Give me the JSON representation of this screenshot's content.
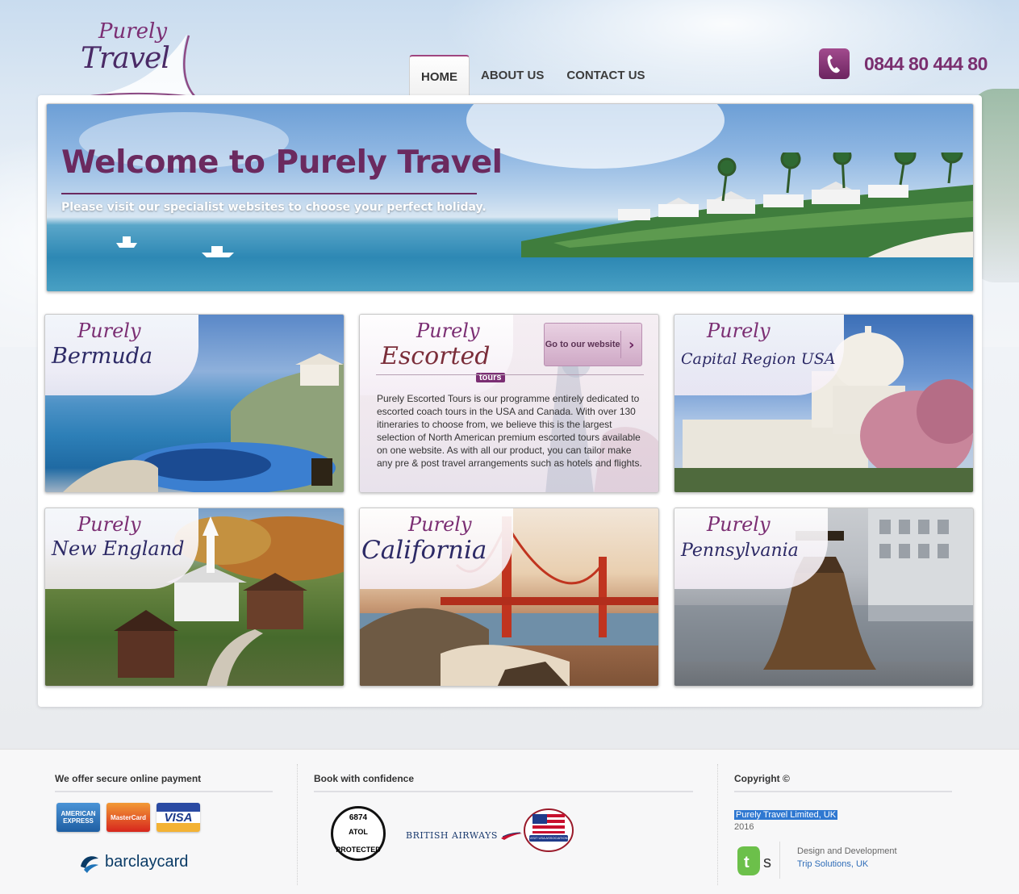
{
  "header": {
    "logo_top": "Purely",
    "logo_bottom": "Travel",
    "nav": [
      {
        "label": "HOME",
        "active": true
      },
      {
        "label": "ABOUT US",
        "active": false
      },
      {
        "label": "CONTACT US",
        "active": false
      }
    ],
    "phone": "0844 80 444 80"
  },
  "hero": {
    "title": "Welcome to Purely Travel",
    "subtitle": "Please visit our specialist websites to choose your perfect holiday."
  },
  "tiles": [
    {
      "prefix": "Purely",
      "name": "Bermuda"
    },
    {
      "prefix": "Purely",
      "name": "Escorted",
      "tag": "tours",
      "cta": "Go to our website",
      "description": "Purely Escorted Tours is our programme entirely dedicated to escorted coach tours in the USA and Canada. With over 130 itineraries to choose from, we believe this is the largest selection of North American premium escorted tours available on one website. As with all our product, you can tailor make any pre & post travel arrangements such as hotels and flights."
    },
    {
      "prefix": "Purely",
      "name": "Capital Region USA"
    },
    {
      "prefix": "Purely",
      "name": "New England"
    },
    {
      "prefix": "Purely",
      "name": "California"
    },
    {
      "prefix": "Purely",
      "name": "Pennsylvania"
    }
  ],
  "footer": {
    "payment_heading": "We offer secure online payment",
    "cards": [
      "AMERICAN EXPRESS",
      "MasterCard",
      "VISA"
    ],
    "barclaycard": "barclaycard",
    "confidence_heading": "Book with confidence",
    "atol_number": "6874",
    "atol_label": "ATOL",
    "atol_protected": "PROTECTED",
    "british_airways": "BRITISH AIRWAYS",
    "visit_usa": "VISIT USA ASSOCIATION",
    "copyright_heading": "Copyright ©",
    "company": "Purely Travel Limited, UK",
    "year": "2016",
    "design_label": "Design and Development",
    "design_company": "Trip Solutions, UK"
  },
  "colors": {
    "brand_purple": "#6b2a5f",
    "brand_navy": "#2d2a66",
    "link_blue": "#2f6db8"
  }
}
